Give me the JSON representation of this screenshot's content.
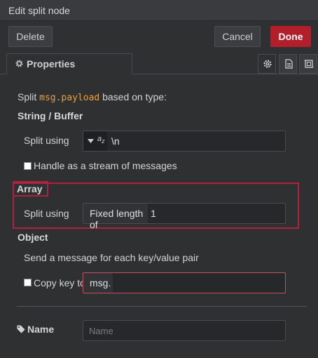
{
  "dialog": {
    "title": "Edit split node",
    "delete_label": "Delete",
    "cancel_label": "Cancel",
    "done_label": "Done"
  },
  "tabs": {
    "properties_label": "Properties",
    "icons": [
      "gear-icon",
      "description-icon",
      "appearance-icon"
    ]
  },
  "intro": {
    "prefix": "Split ",
    "code": "msg.payload",
    "suffix": " based on type:"
  },
  "string_section": {
    "heading": "String / Buffer",
    "split_label": "Split using",
    "type_glyph": "a",
    "type_glyph_sub": "z",
    "split_value": "\\n",
    "stream_label": "Handle as a stream of messages",
    "stream_checked": false
  },
  "array_section": {
    "heading": "Array",
    "split_label": "Split using",
    "mode_label": "Fixed length of",
    "length_value": "1"
  },
  "object_section": {
    "heading": "Object",
    "description": "Send a message for each key/value pair",
    "copy_label": "Copy key to",
    "copy_checked": false,
    "copy_value": "msg."
  },
  "name": {
    "label": "Name",
    "placeholder": "Name",
    "value": ""
  },
  "colors": {
    "accent_done": "#b21e2a",
    "highlight": "#b02040",
    "code": "#e8a23a",
    "background": "#2f3032"
  }
}
